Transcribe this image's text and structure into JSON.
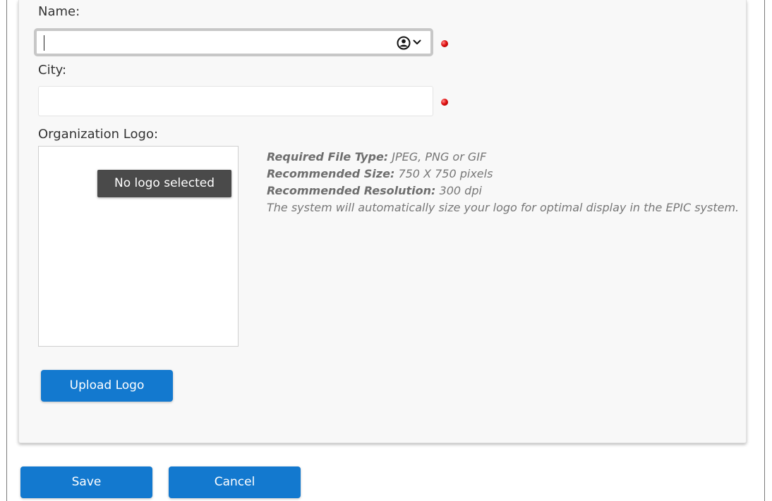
{
  "form": {
    "name_label": "Name:",
    "name_value": "",
    "city_label": "City:",
    "city_value": "",
    "logo_label": "Organization Logo:",
    "logo_placeholder": "No logo selected"
  },
  "logo_info": {
    "file_type_label": "Required File Type:",
    "file_type_value": "JPEG, PNG or GIF",
    "size_label": "Recommended Size:",
    "size_value": "750 X 750 pixels",
    "resolution_label": "Recommended Resolution:",
    "resolution_value": "300 dpi",
    "note": "The system will automatically size your logo for optimal display in the EPIC system."
  },
  "buttons": {
    "upload": "Upload Logo",
    "save": "Save",
    "cancel": "Cancel"
  },
  "icons": {
    "autofill": "person-circle-icon",
    "dropdown": "chevron-down-icon",
    "required": "required-indicator-icon"
  },
  "colors": {
    "primary_button": "#1379cf",
    "required_dot": "#e01010",
    "tooltip_bg": "#4a4a4a"
  }
}
